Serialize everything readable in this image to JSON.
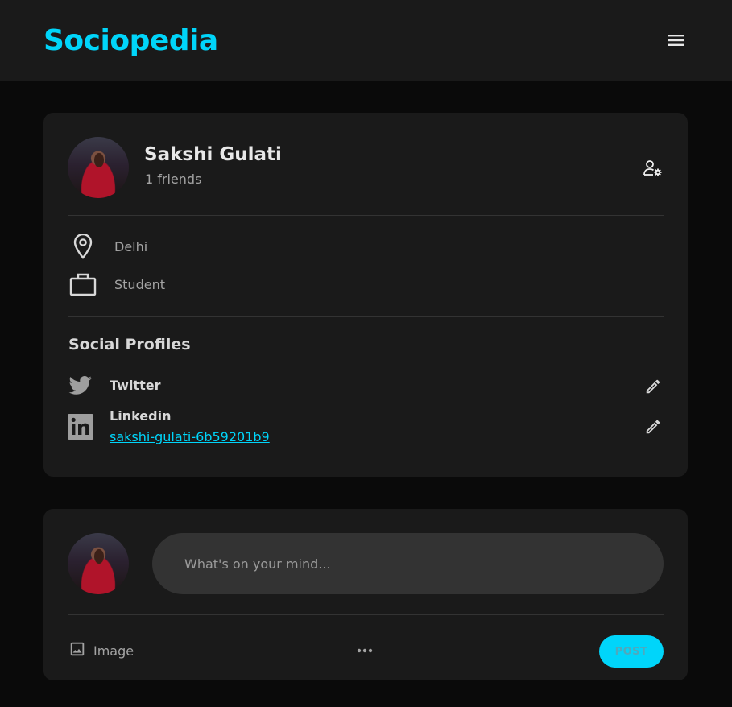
{
  "navbar": {
    "logo": "Sociopedia",
    "menu_icon": "hamburger-menu-icon"
  },
  "profile": {
    "name": "Sakshi Gulati",
    "friends": "1 friends",
    "location": "Delhi",
    "occupation": "Student",
    "icons": {
      "manage": "person-gear-icon",
      "location": "location-pin-icon",
      "occupation": "briefcase-icon"
    }
  },
  "social": {
    "title": "Social Profiles",
    "items": [
      {
        "name": "Twitter",
        "link": "",
        "icon": "twitter-icon"
      },
      {
        "name": "Linkedin",
        "link": "sakshi-gulati-6b59201b9",
        "icon": "linkedin-icon"
      }
    ]
  },
  "post": {
    "placeholder": "What's on your mind...",
    "image_label": "Image",
    "more_icon": "more-horizontal-icon",
    "post_label": "POST"
  },
  "colors": {
    "accent": "#00d5fa",
    "card": "#1a1a1a",
    "background": "#0a0a0a",
    "input": "#333333"
  }
}
